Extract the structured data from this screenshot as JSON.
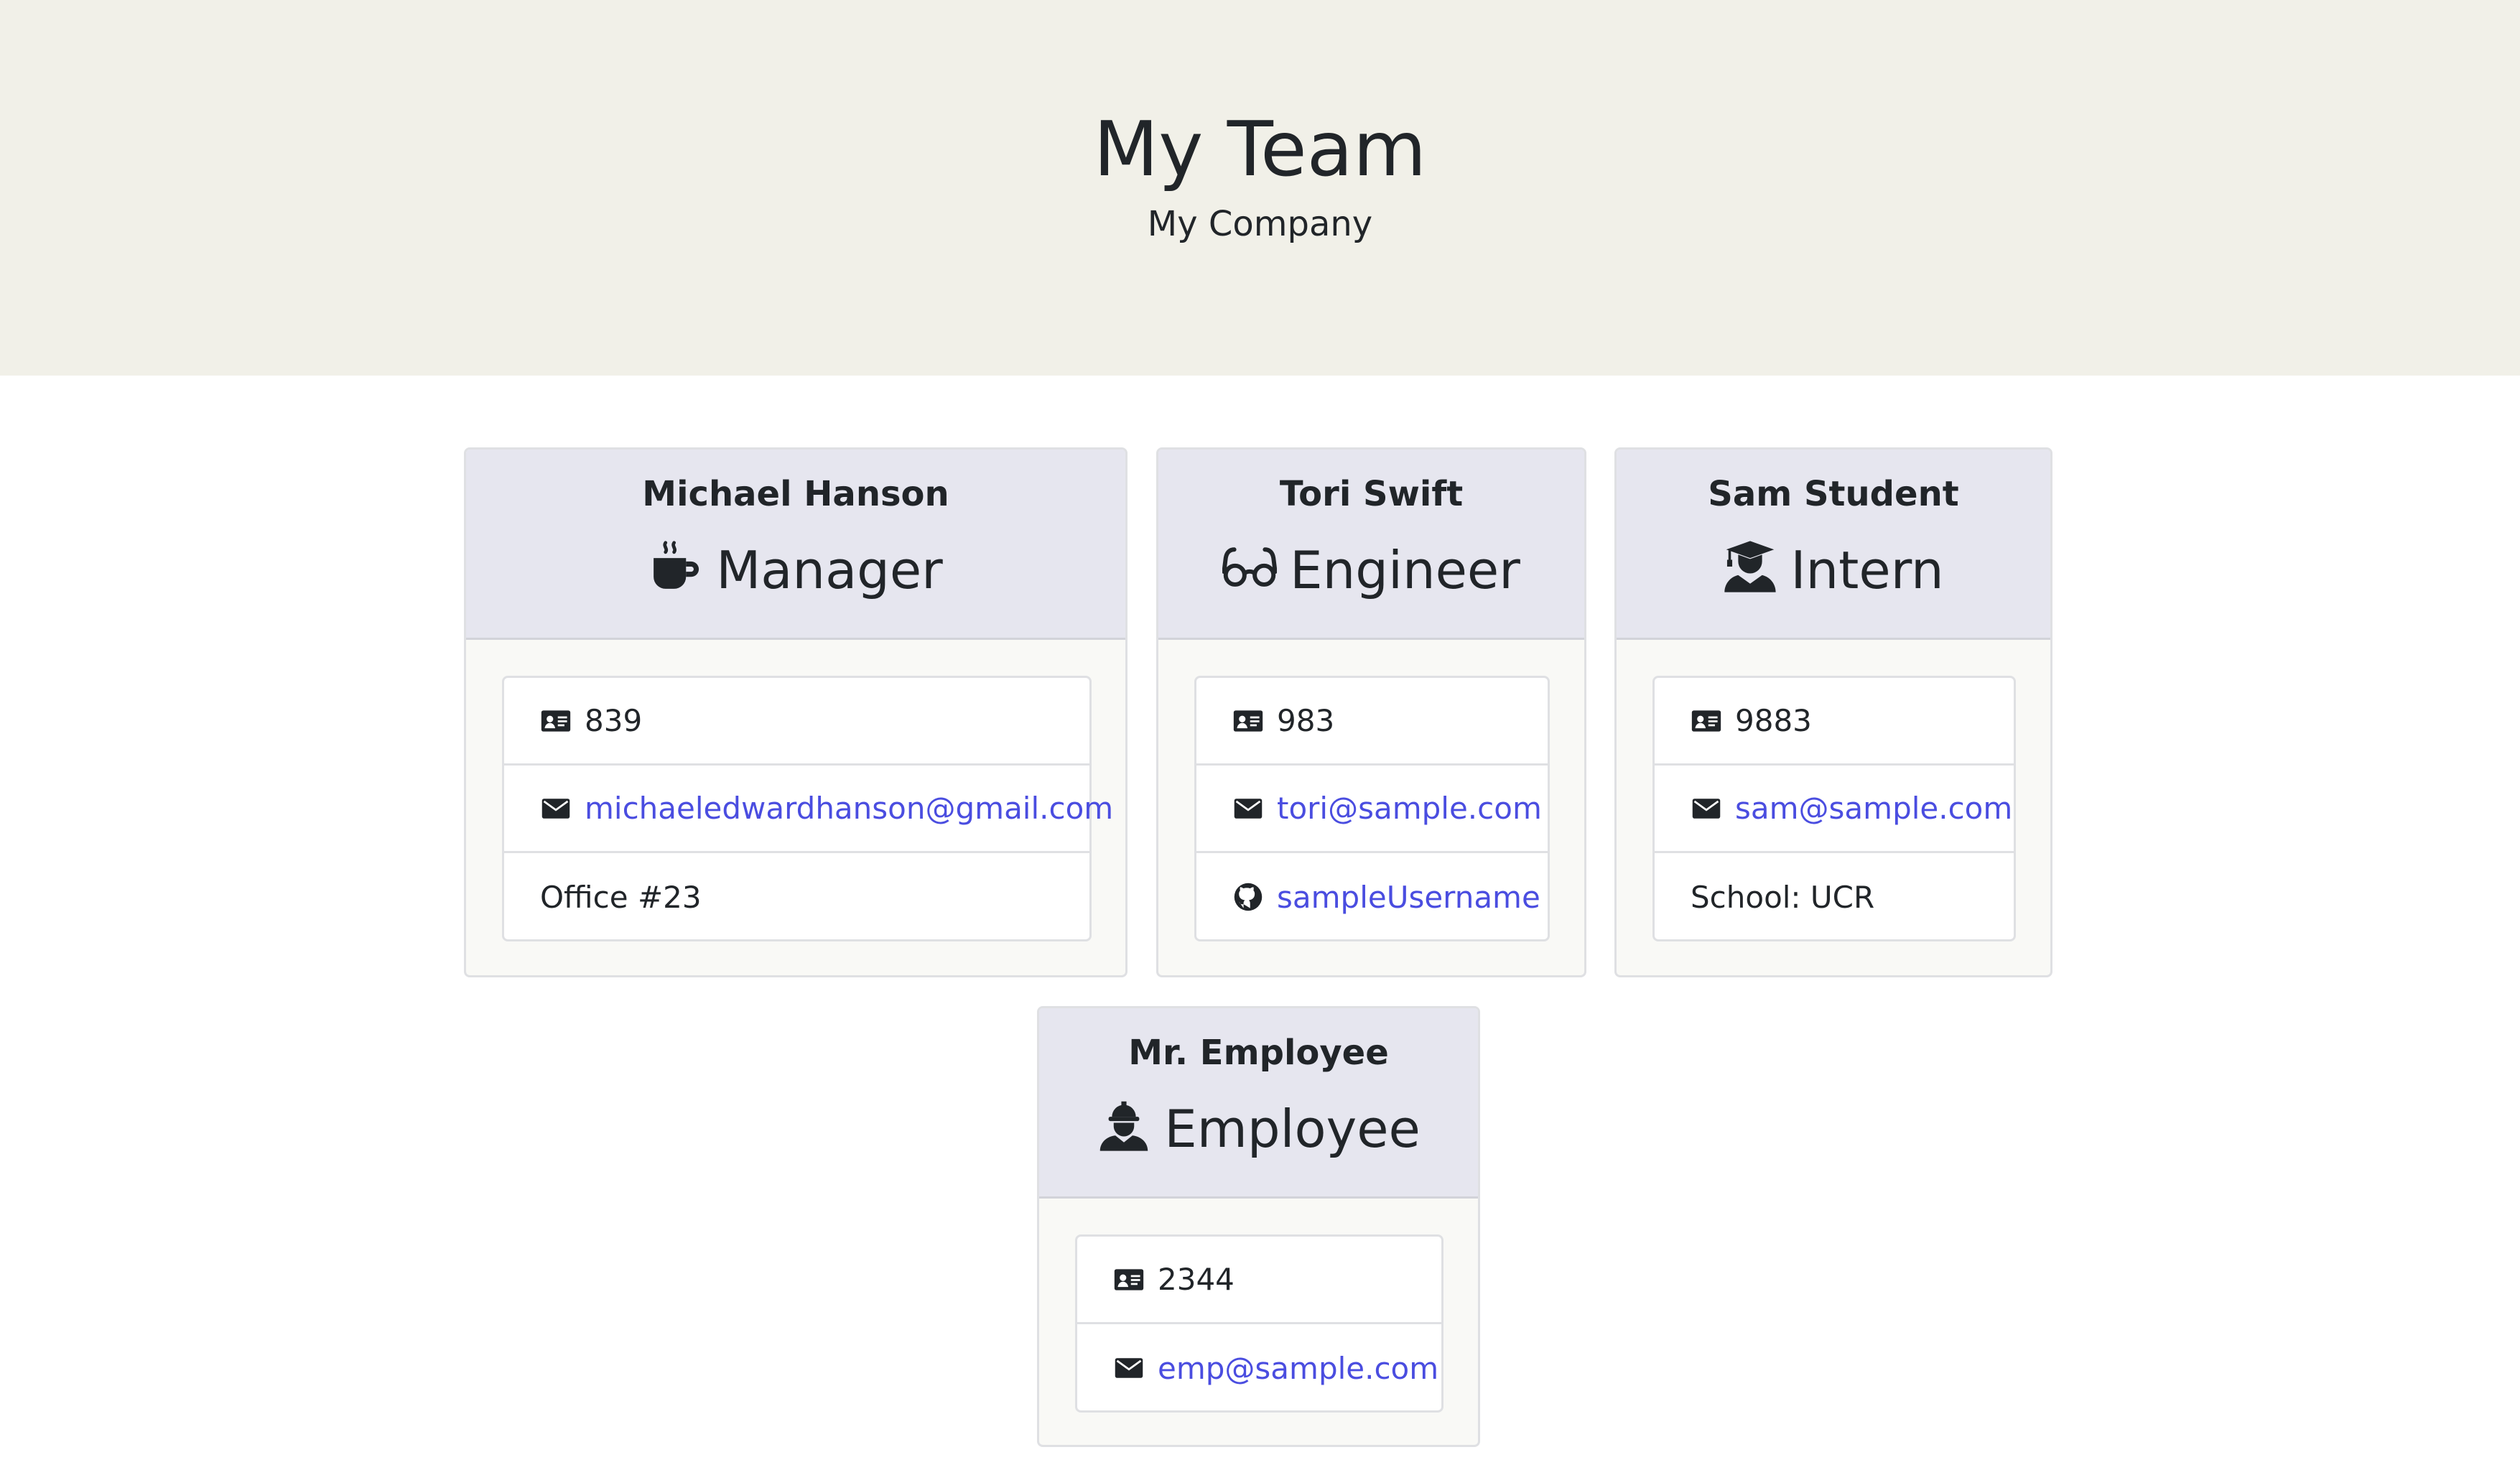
{
  "header": {
    "title": "My Team",
    "subtitle": "My Company"
  },
  "colors": {
    "header_bg": "#f1f0e8",
    "card_header_bg": "#e6e6ef",
    "link": "#4a4de0"
  },
  "cards": [
    {
      "name": "Michael Hanson",
      "role": "Manager",
      "role_icon": "coffee-mug-icon",
      "items": [
        {
          "icon": "id-card-icon",
          "text": "839"
        },
        {
          "icon": "envelope-icon",
          "text": "michaeledwardhanson@gmail.com"
        },
        {
          "text": "Office #23"
        }
      ]
    },
    {
      "name": "Tori Swift",
      "role": "Engineer",
      "role_icon": "glasses-icon",
      "items": [
        {
          "icon": "id-card-icon",
          "text": "983"
        },
        {
          "icon": "envelope-icon",
          "text": "tori@sample.com"
        },
        {
          "icon": "github-icon",
          "text": "sampleUsername"
        }
      ]
    },
    {
      "name": "Sam Student",
      "role": "Intern",
      "role_icon": "graduate-icon",
      "items": [
        {
          "icon": "id-card-icon",
          "text": "9883"
        },
        {
          "icon": "envelope-icon",
          "text": "sam@sample.com"
        },
        {
          "text": "School: UCR"
        }
      ]
    },
    {
      "name": "Mr. Employee",
      "role": "Employee",
      "role_icon": "hard-hat-worker-icon",
      "items": [
        {
          "icon": "id-card-icon",
          "text": "2344"
        },
        {
          "icon": "envelope-icon",
          "text": "emp@sample.com"
        }
      ]
    }
  ]
}
